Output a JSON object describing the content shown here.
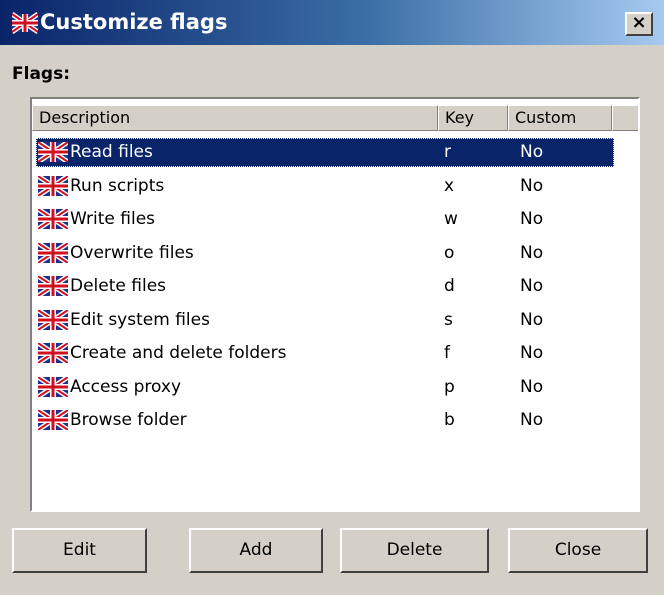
{
  "window": {
    "title": "Customize flags",
    "close_label": "×"
  },
  "flags_label": "Flags:",
  "columns": [
    "Description",
    "Key",
    "Custom"
  ],
  "rows": [
    {
      "description": "Read files",
      "key": "r",
      "custom": "No",
      "selected": true
    },
    {
      "description": "Run scripts",
      "key": "x",
      "custom": "No"
    },
    {
      "description": "Write files",
      "key": "w",
      "custom": "No"
    },
    {
      "description": "Overwrite files",
      "key": "o",
      "custom": "No"
    },
    {
      "description": "Delete files",
      "key": "d",
      "custom": "No"
    },
    {
      "description": "Edit system files",
      "key": "s",
      "custom": "No"
    },
    {
      "description": "Create and delete folders",
      "key": "f",
      "custom": "No"
    },
    {
      "description": "Access proxy",
      "key": "p",
      "custom": "No"
    },
    {
      "description": "Browse folder",
      "key": "b",
      "custom": "No"
    }
  ],
  "buttons": {
    "edit": "Edit",
    "add": "Add",
    "delete": "Delete",
    "close": "Close"
  },
  "colors": {
    "title_start": "#0a246a",
    "title_end": "#a6caf0",
    "selection": "#0a246a",
    "face": "#d4d0c8"
  },
  "icons": {
    "row_icon": "union-jack-flag-icon",
    "title_icon": "union-jack-flag-icon"
  }
}
